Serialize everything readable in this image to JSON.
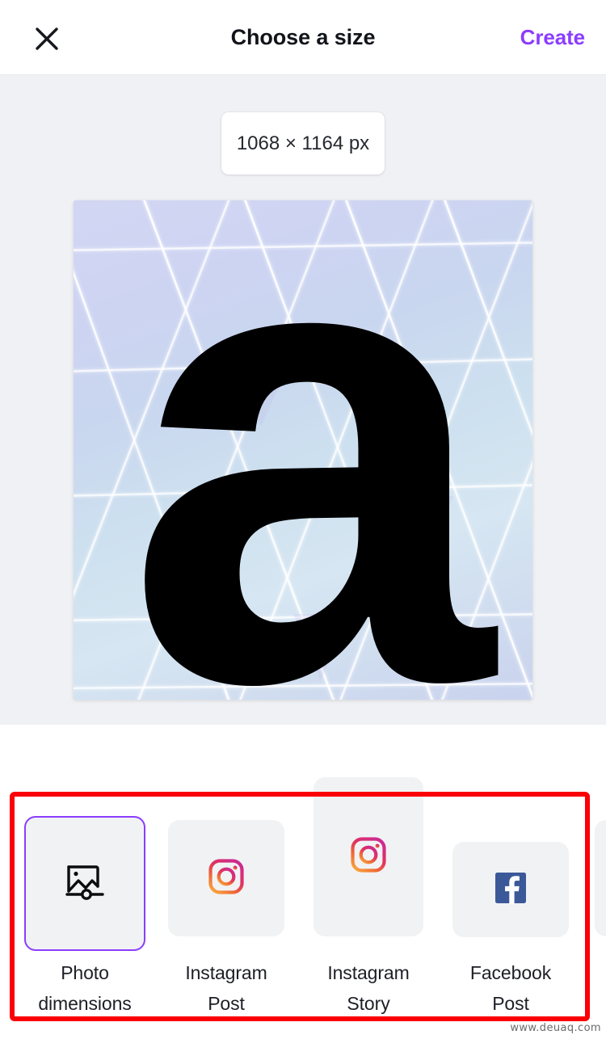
{
  "header": {
    "close_icon": "close-icon",
    "title": "Choose a size",
    "create_label": "Create"
  },
  "stage": {
    "size_chip": "1068 × 1164 px",
    "preview": {
      "letter": "a",
      "description": "pale blue lavender triangular mesh background with black letter a"
    }
  },
  "templates": {
    "items": [
      {
        "label": "Photo\ndimensions",
        "icon": "photo-dimensions-icon",
        "selected": true
      },
      {
        "label": "Instagram\nPost",
        "icon": "instagram-icon",
        "selected": false
      },
      {
        "label": "Instagram\nStory",
        "icon": "instagram-icon",
        "selected": false
      },
      {
        "label": "Facebook\nPost",
        "icon": "facebook-icon",
        "selected": false
      },
      {
        "label": "",
        "icon": "",
        "selected": false
      }
    ]
  },
  "annotation": {
    "highlight_color": "#fb0007"
  },
  "watermark": "www.deuaq.com",
  "colors": {
    "accent_purple": "#8b3dff",
    "stage_bg": "#f0f1f4",
    "thumb_bg": "#f1f2f4",
    "facebook_blue": "#3b5998",
    "text_primary": "#12141a"
  }
}
